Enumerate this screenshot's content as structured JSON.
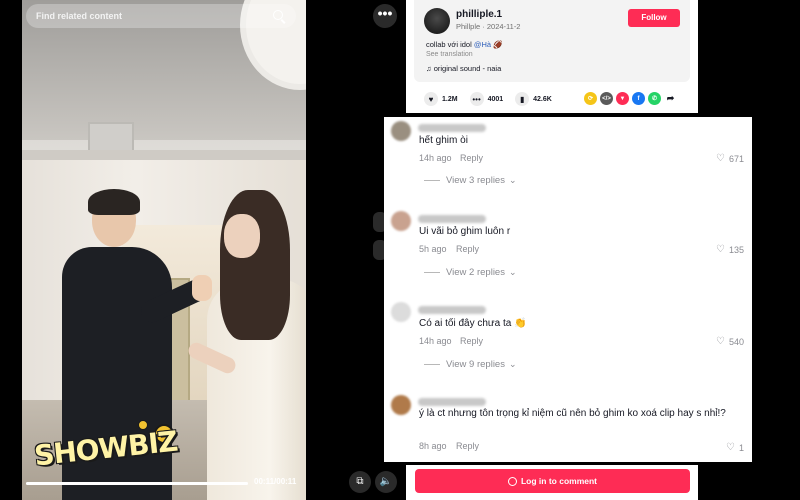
{
  "search": {
    "placeholder": "Find related content"
  },
  "video": {
    "time": "00:11/00:11",
    "progress": 1.0,
    "watermark": "SHOWBIZ"
  },
  "post": {
    "author": "philliple.1",
    "author_meta": "Phillple · 2024-11-2",
    "follow_label": "Follow",
    "caption_prefix": "collab với idol ",
    "caption_tag": "@Hà",
    "caption_emoji": "🏈",
    "see_translation": "See translation",
    "sound_icon": "♫",
    "sound": "original sound - naia",
    "stats": {
      "likes": "1.2M",
      "comments": "4001",
      "saves": "42.6K"
    },
    "share_icons": [
      "repost-icon",
      "embed-icon",
      "send-icon",
      "facebook-icon",
      "whatsapp-icon",
      "share-arrow-icon"
    ]
  },
  "comments": [
    {
      "text": "hết ghim òi",
      "time": "14h ago",
      "reply_label": "Reply",
      "likes": "671",
      "replies_label": "View 3 replies"
    },
    {
      "text": "Ui vãi bỏ ghim luôn r",
      "time": "5h ago",
      "reply_label": "Reply",
      "likes": "135",
      "replies_label": "View 2 replies"
    },
    {
      "text": "Có ai tối đây chưa ta 👏",
      "time": "14h ago",
      "reply_label": "Reply",
      "likes": "540",
      "replies_label": "View 9 replies"
    },
    {
      "text": "ý là ct nhưng tôn trọng kỉ niệm cũ nên bỏ ghim ko xoá clip hay s nhỉ!?",
      "time": "8h ago",
      "reply_label": "Reply",
      "likes": "1",
      "replies_label": ""
    }
  ],
  "more_label": "•••",
  "login_label": "Log in to comment",
  "colors": {
    "accent": "#fe2c55",
    "link": "#2b5db9",
    "muted": "#8a8b91"
  }
}
